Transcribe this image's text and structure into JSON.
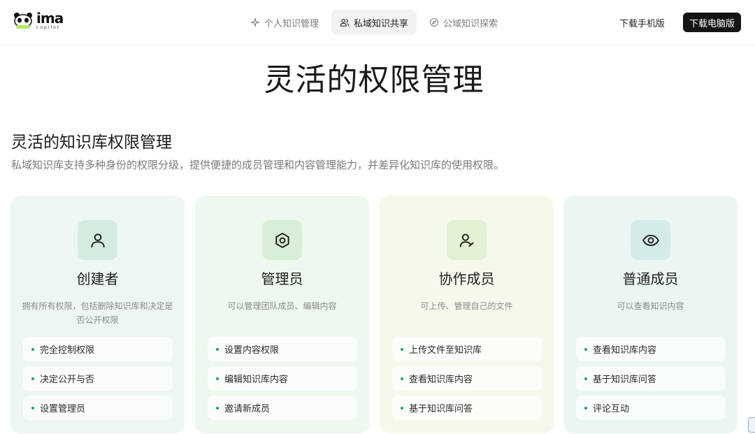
{
  "header": {
    "logo_text": "ima",
    "logo_sub": "copilot",
    "nav": [
      {
        "label": "个人知识管理",
        "icon": "sparkle-icon",
        "active": false
      },
      {
        "label": "私域知识共享",
        "icon": "users-icon",
        "active": true
      },
      {
        "label": "公域知识探索",
        "icon": "compass-icon",
        "active": false
      }
    ],
    "download_mobile": "下载手机版",
    "download_pc": "下载电脑版"
  },
  "hero": {
    "title": "灵活的权限管理"
  },
  "section": {
    "title": "灵活的知识库权限管理",
    "description": "私域知识库支持多种身份的权限分级，提供便捷的成员管理和内容管理能力，并差异化知识库的使用权限。"
  },
  "cards": [
    {
      "role": "创建者",
      "icon": "user-icon",
      "description": "拥有所有权限，包括删除知识库和决定是否公开权限",
      "permissions": [
        "完全控制权限",
        "决定公开与否",
        "设置管理员"
      ]
    },
    {
      "role": "管理员",
      "icon": "hexagon-settings-icon",
      "description": "可以管理团队成员、编辑内容",
      "permissions": [
        "设置内容权限",
        "编辑知识库内容",
        "邀请新成员"
      ]
    },
    {
      "role": "协作成员",
      "icon": "user-edit-icon",
      "description": "可上传、管理自己的文件",
      "permissions": [
        "上传文件至知识库",
        "查看知识库内容",
        "基于知识库问答"
      ]
    },
    {
      "role": "普通成员",
      "icon": "eye-icon",
      "description": "可以查看知识内容",
      "permissions": [
        "查看知识库内容",
        "基于知识库问答",
        "评论互动"
      ]
    }
  ],
  "colors": {
    "accent_green": "#22a06b",
    "dark_button": "#141414"
  }
}
